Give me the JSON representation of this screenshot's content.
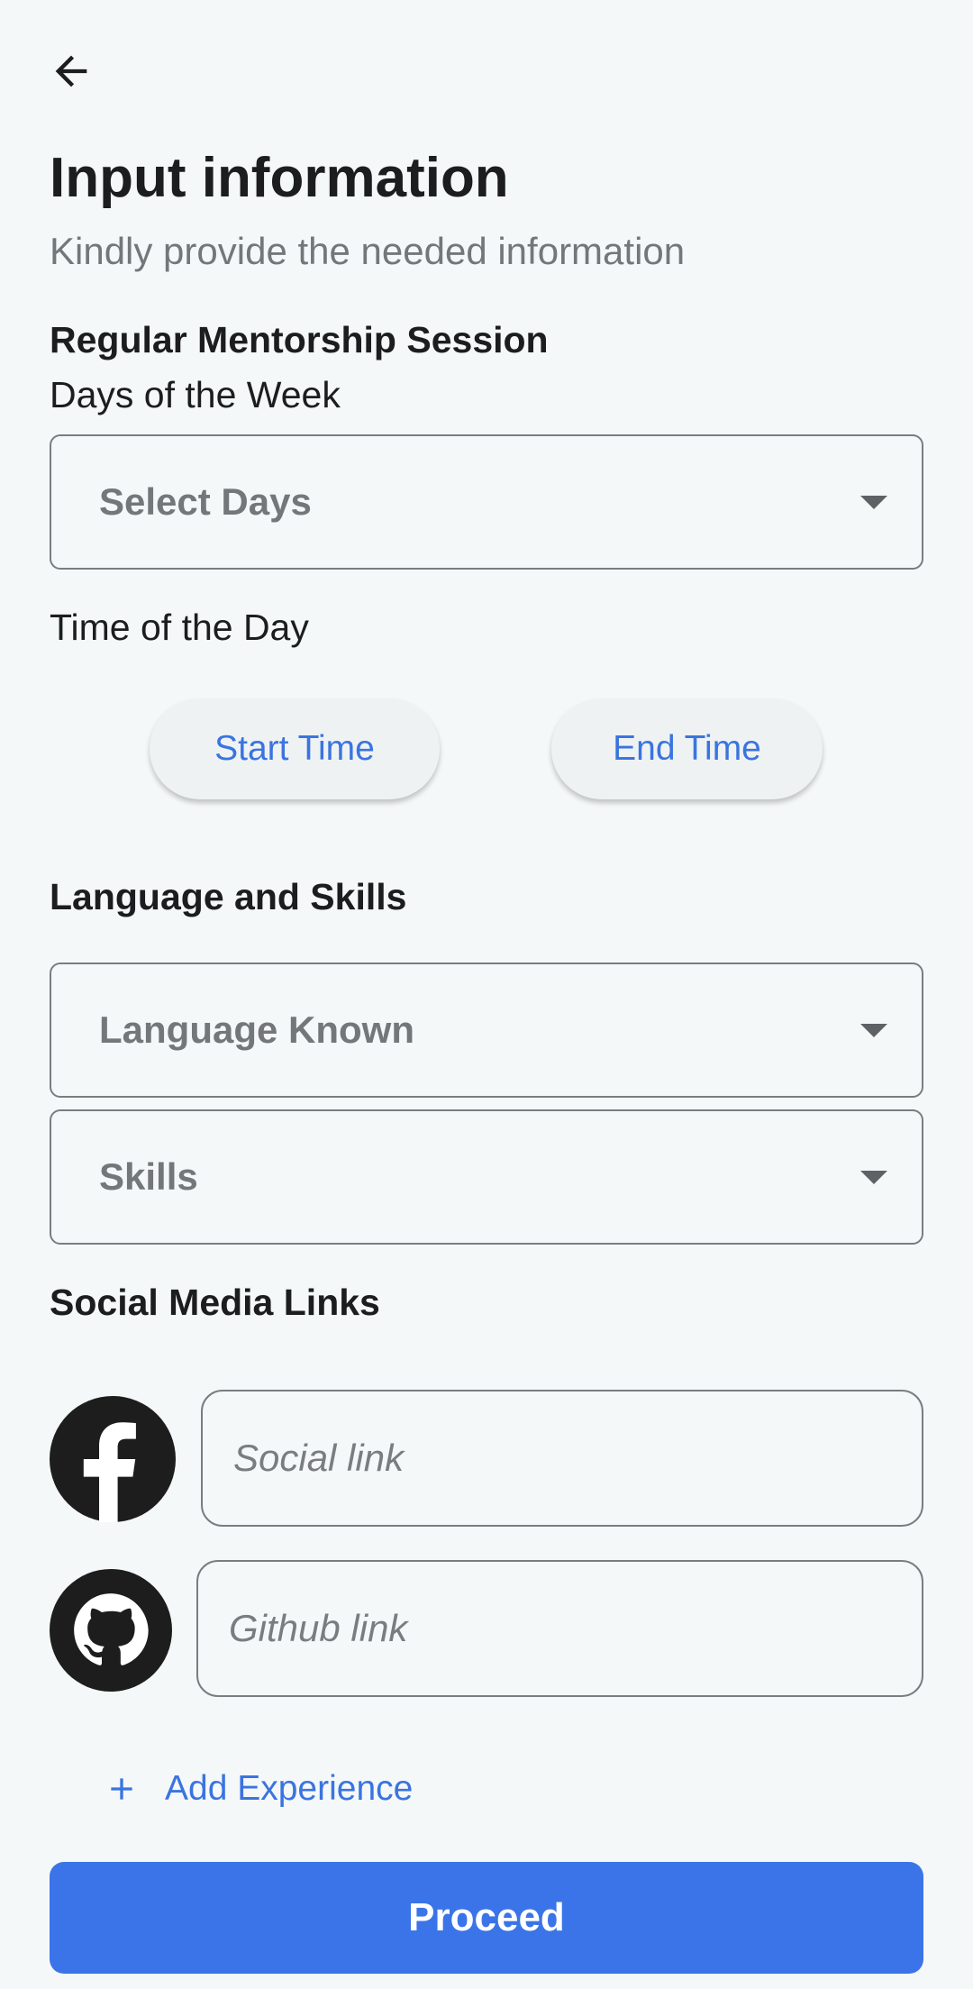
{
  "header": {
    "back_icon": "arrow-left-icon",
    "title": "Input information",
    "subtitle": "Kindly provide the needed information"
  },
  "mentorship": {
    "heading": "Regular Mentorship Session",
    "days_label": "Days of the Week",
    "days_placeholder": "Select Days",
    "time_label": "Time of the Day",
    "start_time": "Start Time",
    "end_time": "End Time"
  },
  "language_skills": {
    "heading": "Language and Skills",
    "language_placeholder": "Language Known",
    "skills_placeholder": "Skills"
  },
  "social": {
    "heading": "Social Media Links",
    "facebook_icon": "facebook-icon",
    "social_placeholder": "Social link",
    "github_icon": "github-icon",
    "github_placeholder": "Github link"
  },
  "actions": {
    "add_experience": "Add Experience",
    "proceed": "Proceed"
  },
  "colors": {
    "accent": "#3a74e8",
    "link_text": "#3a74e0",
    "background": "#f5f8f9"
  }
}
